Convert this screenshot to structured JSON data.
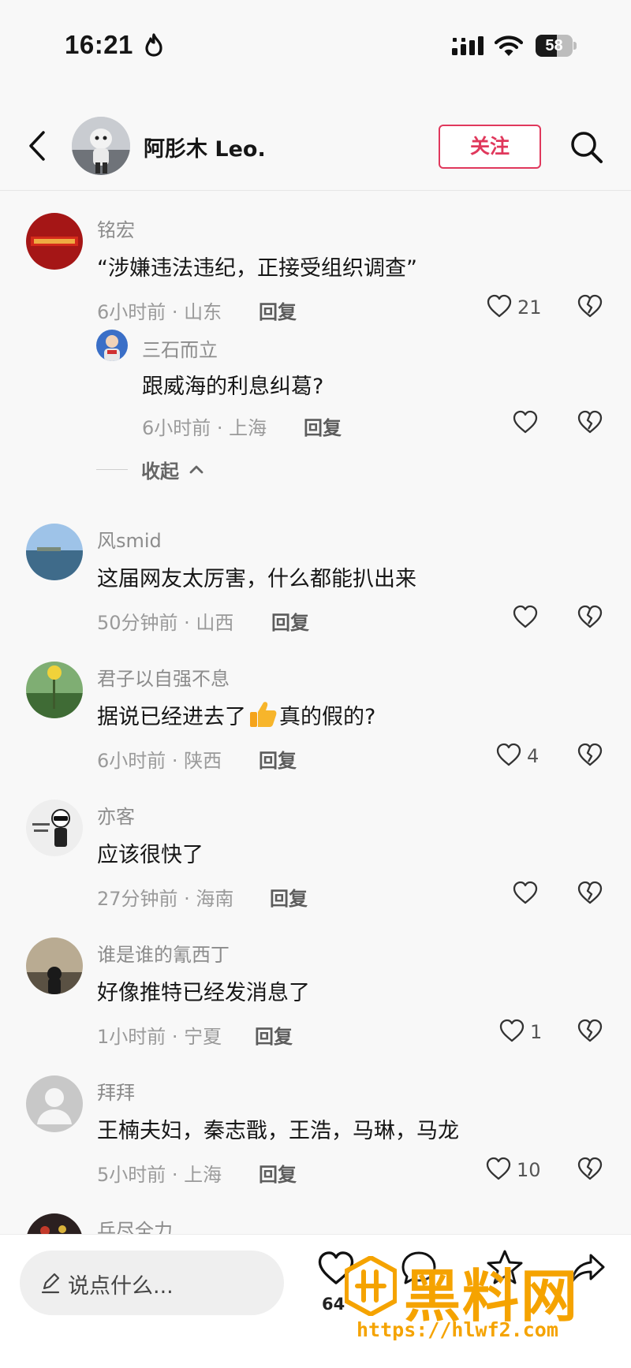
{
  "status_bar": {
    "time": "16:21",
    "battery": "58",
    "battery_fraction": 0.58
  },
  "header": {
    "name": "阿肜木 Leo.",
    "follow_label": "关注"
  },
  "comments": [
    {
      "author": "铭宏",
      "content": "“涉嫌违法违纪，正接受组织调查”",
      "meta": "6小时前 · 山东",
      "reply_label": "回复",
      "likes": "21"
    },
    {
      "author": "风smid",
      "content": "这届网友太厉害，什么都能扒出来",
      "meta": "50分钟前 · 山西",
      "reply_label": "回复",
      "likes": ""
    },
    {
      "author": "君子以自强不息",
      "content": "据说已经进去了",
      "content_after_emoji": "真的假的?",
      "emoji": "thumbs-up",
      "meta": "6小时前 · 陕西",
      "reply_label": "回复",
      "likes": "4"
    },
    {
      "author": "亦客",
      "content": "应该很快了",
      "meta": "27分钟前 · 海南",
      "reply_label": "回复",
      "likes": ""
    },
    {
      "author": "谁是谁的氰西丁",
      "content": "好像推特已经发消息了",
      "meta": "1小时前 · 宁夏",
      "reply_label": "回复",
      "likes": "1"
    },
    {
      "author": "拜拜",
      "content": "王楠夫妇，秦志戬，王浩，马琳，马龙",
      "meta": "5小时前 · 上海",
      "reply_label": "回复",
      "likes": "10"
    },
    {
      "author": "乒尽全力"
    }
  ],
  "reply": {
    "author": "三石而立",
    "content": "跟威海的利息纠葛?",
    "meta": "6小时前 · 上海",
    "reply_label": "回复",
    "likes": ""
  },
  "collapse_label": "收起",
  "bottom_bar": {
    "input_placeholder": "说点什么...",
    "like_count": "64"
  },
  "watermark": {
    "title": "黑料网",
    "url": "https://hlwf2.com"
  },
  "colors": {
    "accent": "#e0385c",
    "watermark": "#f5a300"
  }
}
